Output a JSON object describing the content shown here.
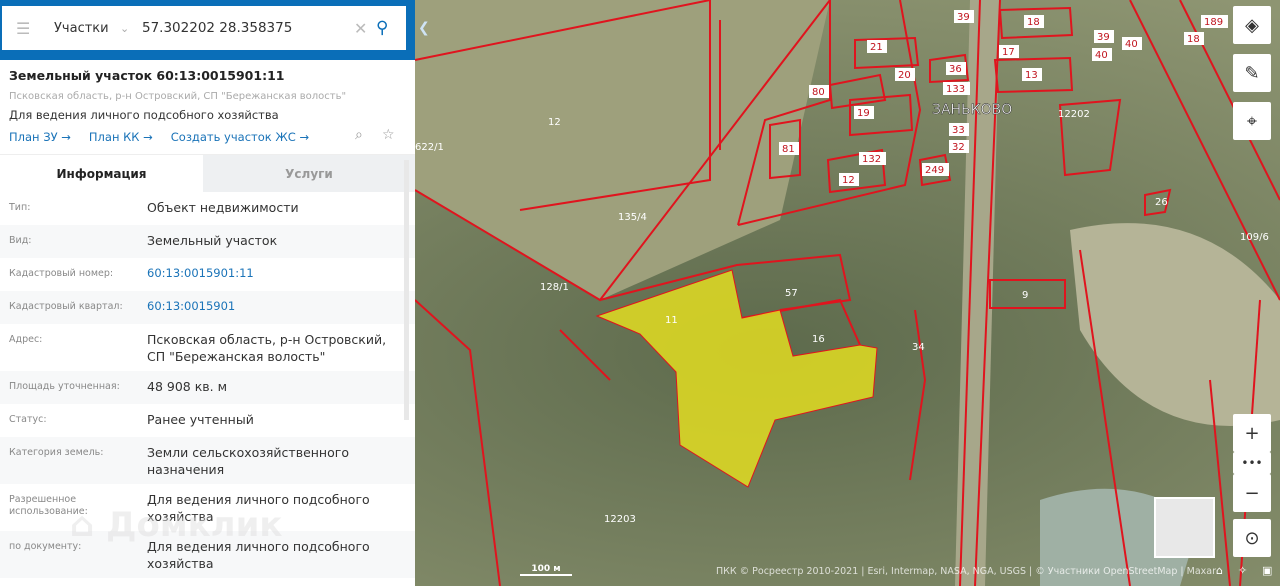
{
  "search": {
    "layer": "Участки",
    "query": "57.302202 28.358375"
  },
  "parcel": {
    "title": "Земельный участок 60:13:0015901:11",
    "address": "Псковская область, р-н Островский, СП \"Бережанская волость\"",
    "use": "Для ведения личного подсобного хозяйства",
    "links": [
      "План ЗУ →",
      "План КК →",
      "Создать участок ЖС →"
    ]
  },
  "tabs": [
    "Информация",
    "Услуги"
  ],
  "rows": [
    {
      "label": "Тип:",
      "value": "Объект недвижимости"
    },
    {
      "label": "Вид:",
      "value": "Земельный участок"
    },
    {
      "label": "Кадастровый номер:",
      "value": "60:13:0015901:11",
      "link": true
    },
    {
      "label": "Кадастровый квартал:",
      "value": "60:13:0015901",
      "link": true
    },
    {
      "label": "Адрес:",
      "value": "Псковская область, р-н Островский, СП \"Бережанская волость\""
    },
    {
      "label": "Площадь уточненная:",
      "value": "48 908 кв. м"
    },
    {
      "label": "Статус:",
      "value": "Ранее учтенный"
    },
    {
      "label": "Категория земель:",
      "value": "Земли сельскохозяйственного назначения"
    },
    {
      "label": "Разрешенное использование:",
      "value": "Для ведения личного подсобного хозяйства"
    },
    {
      "label": "по документу:",
      "value": "Для ведения личного подсобного хозяйства"
    }
  ],
  "watermark": "Домклик",
  "map": {
    "village": "ЗАНЬКОВО",
    "scale": "100 м",
    "attribution": "ПКК © Росреестр 2010-2021 | Esri, Intermap, NASA, NGA, USGS | © Участники OpenStreetMap | Maxar",
    "labels": [
      "12",
      "135/4",
      "128/1",
      "622/1",
      "57",
      "16",
      "11",
      "34",
      "9",
      "26",
      "109/6",
      "12203",
      "21",
      "20",
      "80",
      "19",
      "81",
      "132",
      "12",
      "249",
      "33",
      "32",
      "133",
      "36",
      "39",
      "18",
      "17",
      "13",
      "39",
      "40",
      "40",
      "12202",
      "189",
      "18"
    ],
    "colors": {
      "boundary": "#e0141e",
      "selected": "#e6e020",
      "brand": "#0a6eb8"
    }
  }
}
